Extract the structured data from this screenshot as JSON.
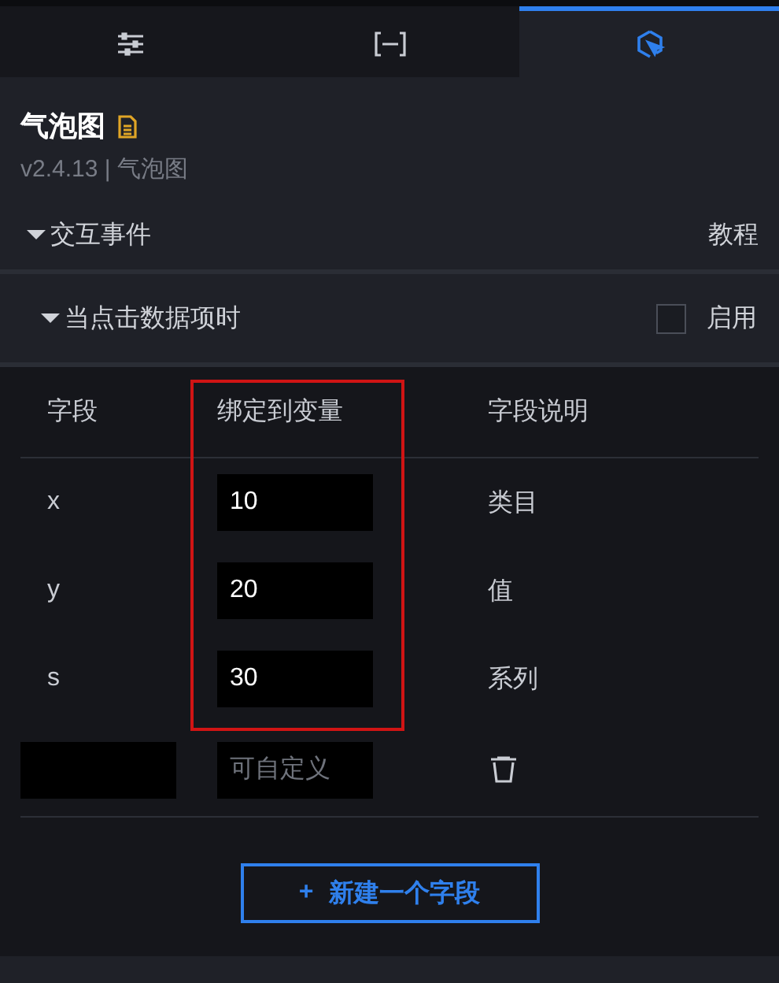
{
  "tabs": [
    {
      "kind": "sliders",
      "selected": false
    },
    {
      "kind": "bracket",
      "selected": false
    },
    {
      "kind": "interaction",
      "selected": true
    }
  ],
  "component": {
    "title": "气泡图",
    "version": "v2.4.13 | 气泡图"
  },
  "section": {
    "title": "交互事件",
    "expanded": true,
    "link": "教程"
  },
  "event": {
    "title": "当点击数据项时",
    "expanded": true,
    "enable_label": "启用",
    "checked": false
  },
  "table": {
    "columns": [
      {
        "label": "字段",
        "highlighted": false
      },
      {
        "label": "绑定到变量",
        "highlighted": true
      },
      {
        "label": "字段说明",
        "highlighted": false
      }
    ],
    "rows": [
      {
        "kind": "fixed",
        "field": "x",
        "variable": "10",
        "description": "类目"
      },
      {
        "kind": "fixed",
        "field": "y",
        "variable": "20",
        "description": "值"
      },
      {
        "kind": "fixed",
        "field": "s",
        "variable": "30",
        "description": "系列"
      },
      {
        "kind": "custom",
        "variable_placeholder": "可自定义"
      }
    ]
  },
  "add_button": {
    "icon": "+",
    "label": "新建一个字段"
  }
}
